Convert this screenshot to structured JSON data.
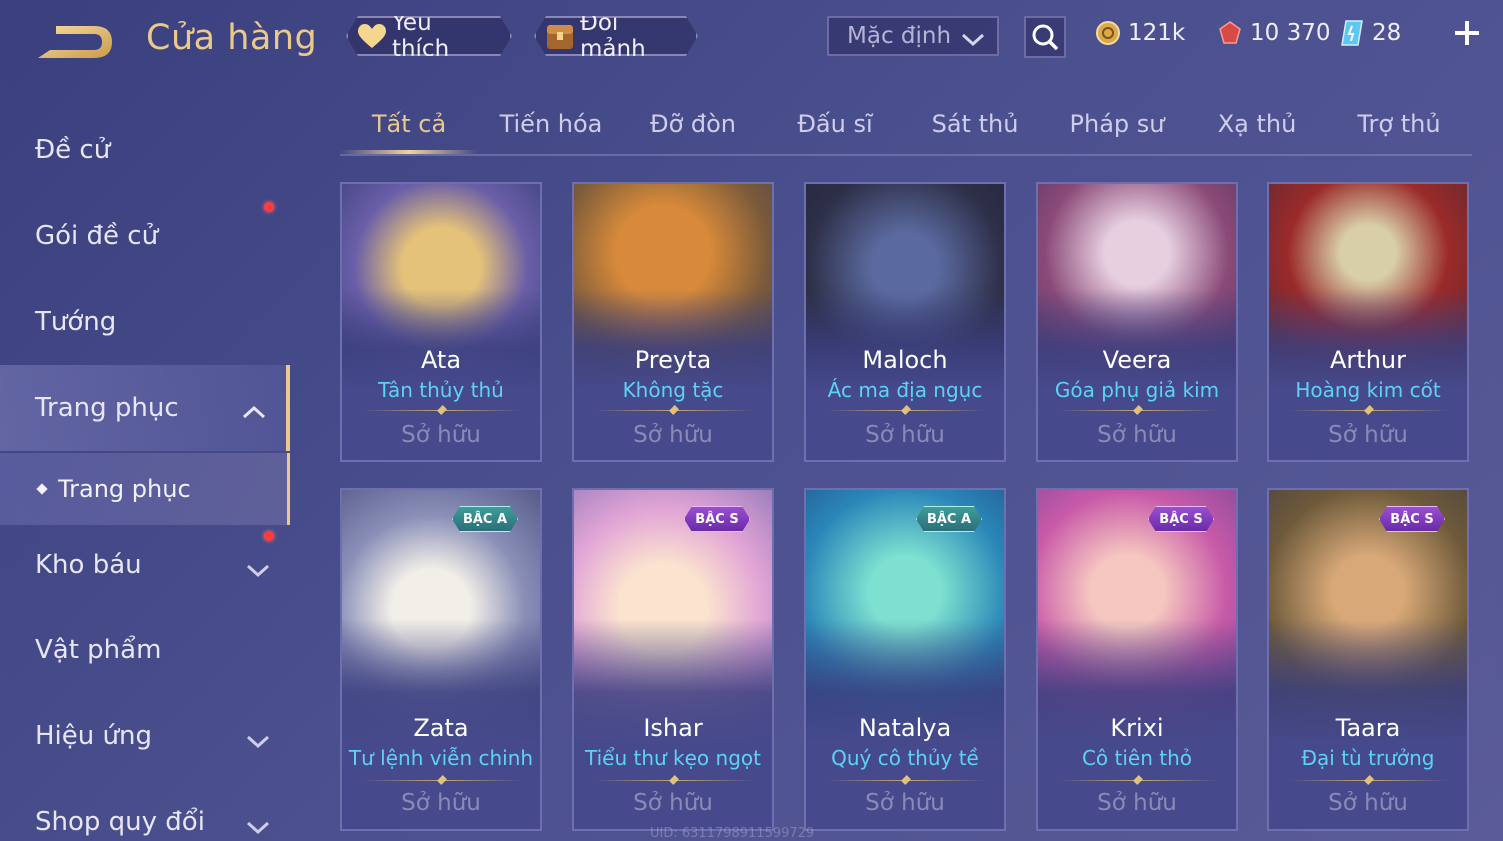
{
  "header": {
    "title": "Cửa hàng",
    "favorite_label": "Yêu thích",
    "exchange_label": "Đổi mảnh",
    "sort_value": "Mặc định",
    "currencies": [
      {
        "name": "gold",
        "value": "121k"
      },
      {
        "name": "voucher",
        "value": "10 370"
      },
      {
        "name": "gem",
        "value": "28"
      }
    ]
  },
  "sidebar": {
    "items": [
      {
        "label": "Đề cử"
      },
      {
        "label": "Gói đề cử"
      },
      {
        "label": "Tướng"
      },
      {
        "label": "Trang phục"
      },
      {
        "label": "Trang phục"
      },
      {
        "label": "Kho báu"
      },
      {
        "label": "Vật phẩm"
      },
      {
        "label": "Hiệu ứng"
      },
      {
        "label": "Shop quy đổi"
      }
    ]
  },
  "tabs": [
    {
      "label": "Tất cả"
    },
    {
      "label": "Tiến hóa"
    },
    {
      "label": "Đỡ đòn"
    },
    {
      "label": "Đấu sĩ"
    },
    {
      "label": "Sát thủ"
    },
    {
      "label": "Pháp sư"
    },
    {
      "label": "Xạ thủ"
    },
    {
      "label": "Trợ thủ"
    }
  ],
  "cards": [
    {
      "hero": "Ata",
      "skin": "Tân thủy thủ",
      "status": "Sở hữu",
      "badge": ""
    },
    {
      "hero": "Preyta",
      "skin": "Không tặc",
      "status": "Sở hữu",
      "badge": ""
    },
    {
      "hero": "Maloch",
      "skin": "Ác ma địa ngục",
      "status": "Sở hữu",
      "badge": ""
    },
    {
      "hero": "Veera",
      "skin": "Góa phụ giả kim",
      "status": "Sở hữu",
      "badge": ""
    },
    {
      "hero": "Arthur",
      "skin": "Hoàng kim cốt",
      "status": "Sở hữu",
      "badge": ""
    },
    {
      "hero": "Zata",
      "skin": "Tư lệnh viễn chinh",
      "status": "Sở hữu",
      "badge": "BẬC A"
    },
    {
      "hero": "Ishar",
      "skin": "Tiểu thư kẹo ngọt",
      "status": "Sở hữu",
      "badge": "BẬC S"
    },
    {
      "hero": "Natalya",
      "skin": "Quý cô thủy tề",
      "status": "Sở hữu",
      "badge": "BẬC A"
    },
    {
      "hero": "Krixi",
      "skin": "Cô tiên thỏ",
      "status": "Sở hữu",
      "badge": "BẬC S"
    },
    {
      "hero": "Taara",
      "skin": "Đại tù trưởng",
      "status": "Sở hữu",
      "badge": "BẬC S"
    }
  ],
  "colors": {
    "accent_gold": "#e9c98c",
    "skin_name_cyan": "#5ed2f4",
    "badge_a": "#3f9c9a",
    "badge_s": "#9a4fd0",
    "notification_red": "#ff3b3b"
  },
  "footer": {
    "uid": "UID: 6311798911599729"
  }
}
